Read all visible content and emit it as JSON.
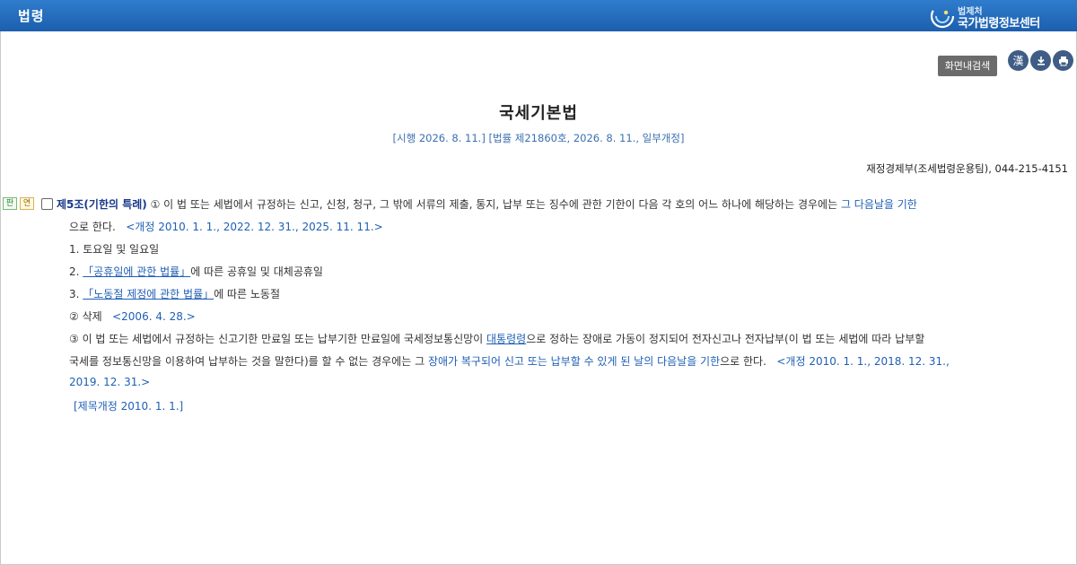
{
  "header": {
    "title": "법령",
    "logo_small": "법제처",
    "logo_big": "국가법령정보센터"
  },
  "toolbar": {
    "search_label": "화면내검색",
    "hanja_label": "漢"
  },
  "law": {
    "title": "국세기본법",
    "enforcement": "[시행 2026. 8. 11.] [법률 제21860호, 2026. 8. 11., 일부개정]",
    "ministry": "재정경제부(조세법령운용팀), 044-215-4151"
  },
  "badges": {
    "precedent": "판",
    "history": "연"
  },
  "article": {
    "heading": "제5조(기한의 특례)",
    "p1_text": " ① 이 법 또는 세법에서 규정하는 신고, 신청, 청구, 그 밖에 서류의 제출, 통지, 납부 또는 징수에 관한 기한이 다음 각 호의 어느 하나에 해당하는 경우에는 ",
    "p1_blue": "그 다음날을 기한",
    "p1_end": "으로 한다.",
    "p1_amend": "<개정 2010. 1. 1., 2022. 12. 31., 2025. 11. 11.>",
    "item1": "1. 토요일 및 일요일",
    "item2_num": "2. ",
    "item2_link": "「공휴일에 관한 법률」",
    "item2_rest": "에 따른 공휴일 및 대체공휴일",
    "item3_num": "3. ",
    "item3_link": "「노동절 제정에 관한 법률」",
    "item3_rest": "에 따른 노동절",
    "p2_text": "② 삭제",
    "p2_amend": "<2006. 4. 28.>",
    "p3_a": "③ 이 법 또는 세법에서 규정하는 신고기한 만료일 또는 납부기한 만료일에 국세정보통신망이 ",
    "p3_link": "대통령령",
    "p3_b": "으로 정하는 장애로 가동이 정지되어 전자신고나 전자납부(이 법 또는 세법에 따라 납부할",
    "p3_c": "국세를 정보통신망을 이용하여 납부하는 것을 말한다)를 할 수 없는 경우에는 그 ",
    "p3_blue": "장애가 복구되어 신고 또는 납부할 수 있게 된 날의 다음날을 기한",
    "p3_d": "으로 한다.",
    "p3_amend1": "<개정 2010. 1. 1., 2018. 12. 31.,",
    "p3_amend2": "2019. 12. 31.>",
    "title_amend": "[제목개정 2010. 1. 1.]"
  }
}
